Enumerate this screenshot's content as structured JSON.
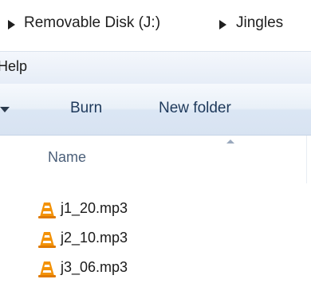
{
  "address_bar": {
    "crumbs": [
      {
        "label": "Removable Disk (J:)"
      },
      {
        "label": "Jingles"
      }
    ]
  },
  "menu_bar": {
    "items": [
      {
        "label": "Help"
      }
    ]
  },
  "toolbar": {
    "burn_label": "Burn",
    "new_folder_label": "New folder"
  },
  "file_list": {
    "columns": [
      {
        "label": "Name"
      }
    ],
    "files": [
      {
        "name": "j1_20.mp3",
        "icon": "vlc-cone-icon"
      },
      {
        "name": "j2_10.mp3",
        "icon": "vlc-cone-icon"
      },
      {
        "name": "j3_06.mp3",
        "icon": "vlc-cone-icon"
      }
    ]
  },
  "colors": {
    "toolbar_text": "#1e395b",
    "vlc_orange": "#f39207"
  }
}
